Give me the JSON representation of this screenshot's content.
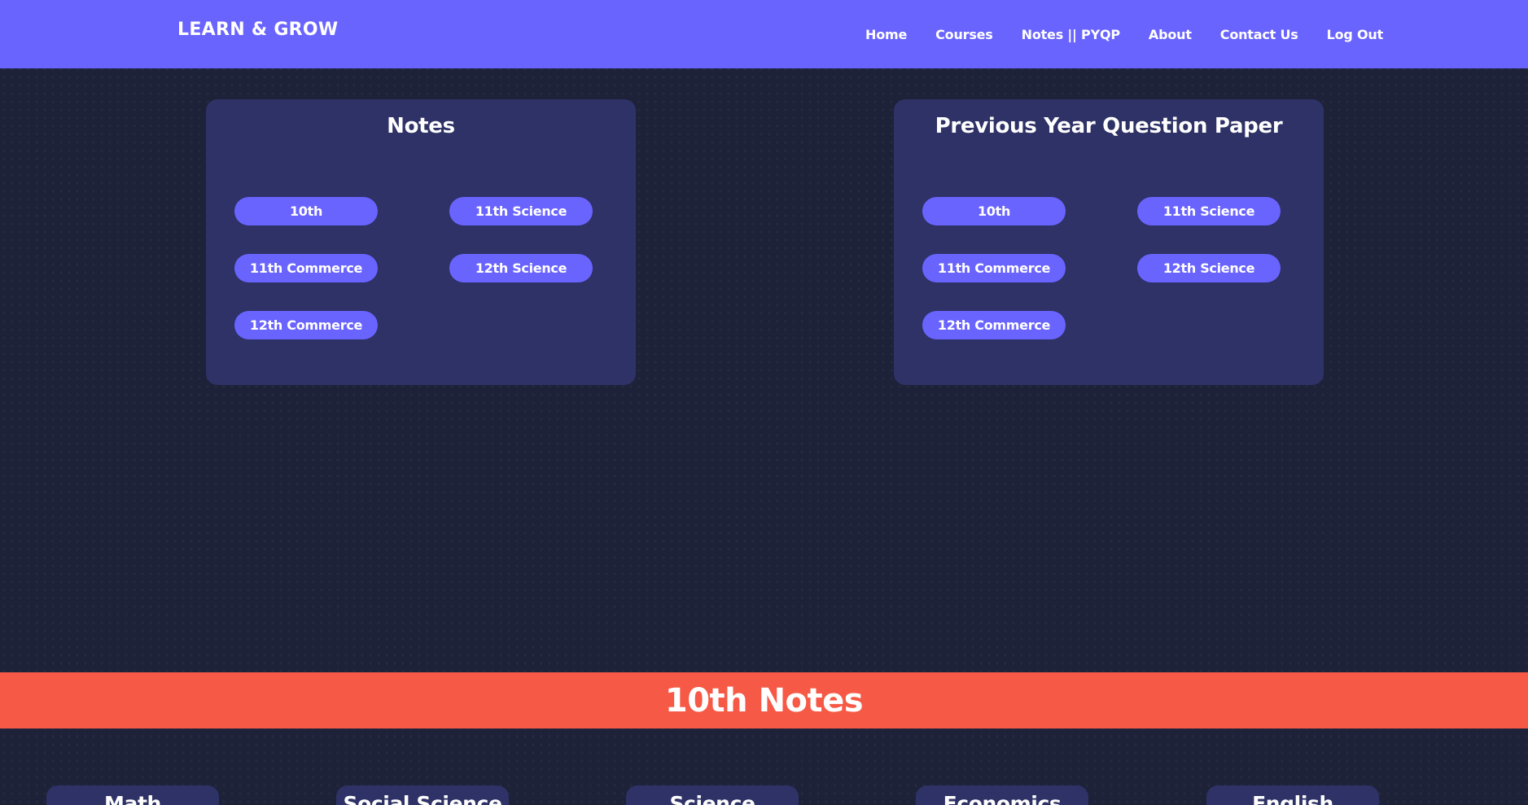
{
  "header": {
    "brand": "LEARN & GROW",
    "nav": [
      "Home",
      "Courses",
      "Notes || PYQP",
      "About",
      "Contact Us",
      "Log Out"
    ]
  },
  "notes_card": {
    "title": "Notes",
    "buttons": [
      "10th",
      "11th Science",
      "11th Commerce",
      "12th Science",
      "12th Commerce"
    ]
  },
  "pyqp_card": {
    "title": "Previous Year Question Paper",
    "buttons": [
      "10th",
      "11th Science",
      "11th Commerce",
      "12th Science",
      "12th Commerce"
    ]
  },
  "section": {
    "title": "10th Notes",
    "subjects": [
      "Math",
      "Social Science",
      "Science",
      "Economics",
      "English"
    ]
  },
  "colors": {
    "accent": "#6a64ff",
    "banner": "#f65945",
    "card": "#2e3266",
    "background": "#1d2239"
  }
}
